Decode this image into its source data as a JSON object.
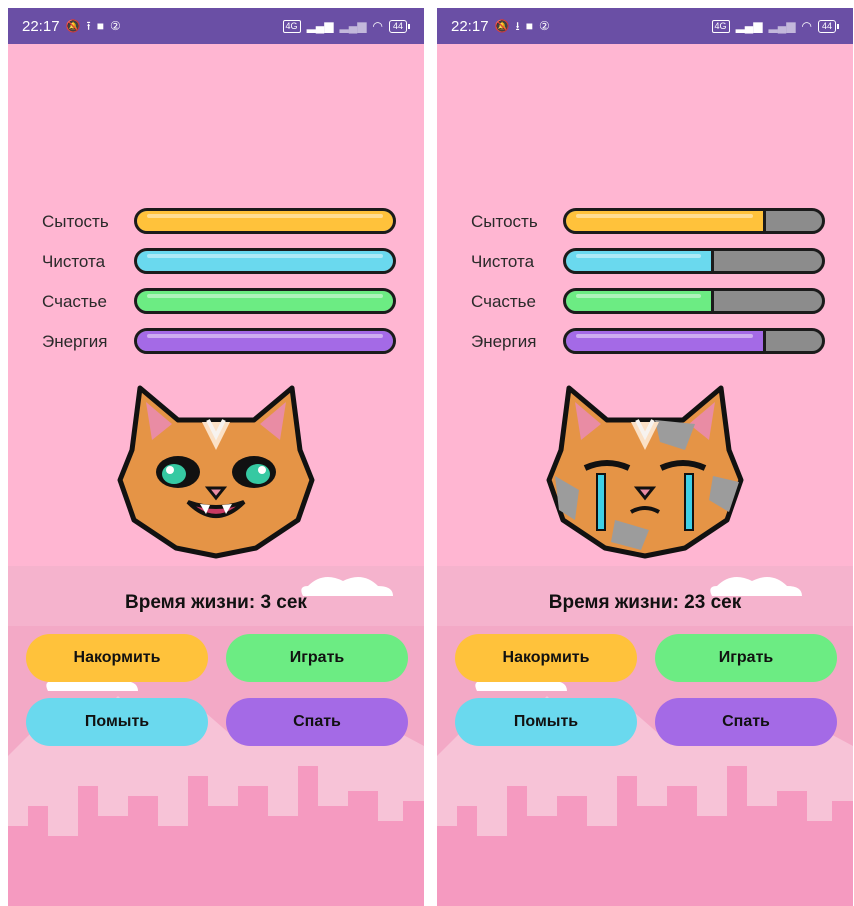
{
  "colors": {
    "status_bar": "#6a4fa5",
    "background": "#ffb6d2",
    "satiety": "#ffc23b",
    "cleanliness": "#6ad9ee",
    "happiness": "#6cec83",
    "energy": "#a46ae6",
    "bar_empty": "#8c8c8c"
  },
  "screens": [
    {
      "status": {
        "time": "22:17",
        "network": "4G",
        "battery": "44",
        "icons_left": [
          "mute-icon",
          "upload-icon",
          "video-icon",
          "sim-icon"
        ],
        "icons_right": [
          "volte-icon",
          "signal-icon",
          "signal-icon",
          "wifi-icon",
          "battery-icon"
        ]
      },
      "stats": [
        {
          "label": "Сытость",
          "level": 1.0,
          "color": "#ffc23b"
        },
        {
          "label": "Чистота",
          "level": 1.0,
          "color": "#6ad9ee"
        },
        {
          "label": "Счастье",
          "level": 1.0,
          "color": "#6cec83"
        },
        {
          "label": "Энергия",
          "level": 1.0,
          "color": "#a46ae6"
        }
      ],
      "pet_mood": "happy",
      "lifetime": "Время жизни: 3 сек",
      "buttons": {
        "feed": "Накормить",
        "play": "Играть",
        "wash": "Помыть",
        "sleep": "Спать"
      }
    },
    {
      "status": {
        "time": "22:17",
        "network": "4G",
        "battery": "44",
        "icons_left": [
          "mute-icon",
          "download-icon",
          "video-icon",
          "sim-icon"
        ],
        "icons_right": [
          "volte-icon",
          "signal-icon",
          "signal-icon",
          "wifi-icon",
          "battery-icon"
        ]
      },
      "stats": [
        {
          "label": "Сытость",
          "level": 0.78,
          "color": "#ffc23b"
        },
        {
          "label": "Чистота",
          "level": 0.58,
          "color": "#6ad9ee"
        },
        {
          "label": "Счастье",
          "level": 0.58,
          "color": "#6cec83"
        },
        {
          "label": "Энергия",
          "level": 0.78,
          "color": "#a46ae6"
        }
      ],
      "pet_mood": "crying",
      "lifetime": "Время жизни: 23 сек",
      "buttons": {
        "feed": "Накормить",
        "play": "Играть",
        "wash": "Помыть",
        "sleep": "Спать"
      }
    }
  ]
}
